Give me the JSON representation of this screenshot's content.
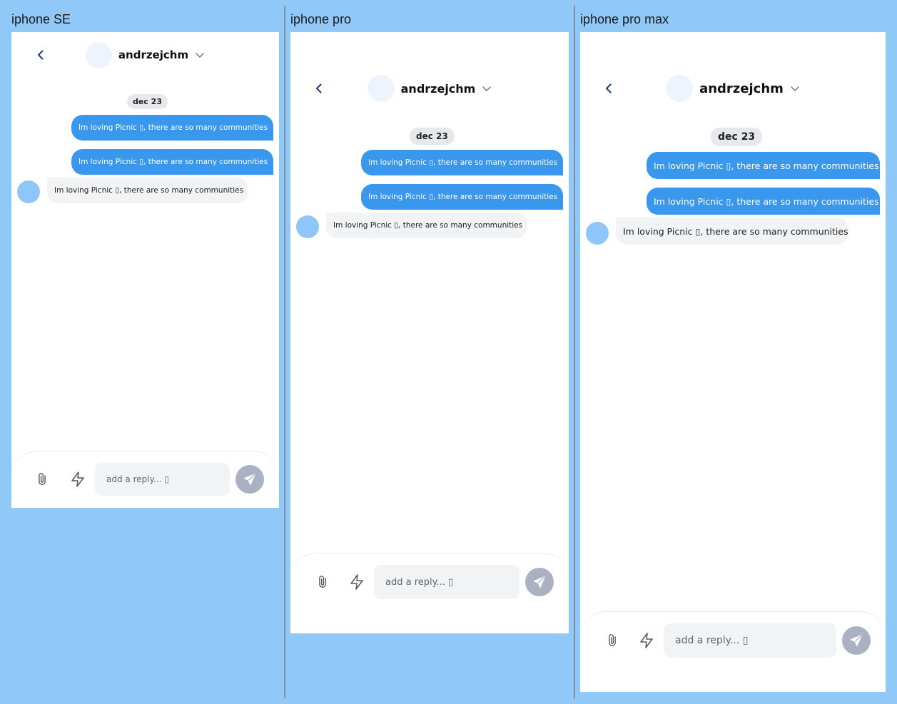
{
  "devices": [
    {
      "label": "iphone SE",
      "header": {
        "username": "andrzejchm"
      },
      "date": "dec 23",
      "messages": [
        {
          "text": "Im loving Picnic ▯, there are so many communities"
        },
        {
          "text": "Im loving Picnic ▯, there are so many communities"
        },
        {
          "text": "Im loving Picnic ▯, there are so many communities"
        }
      ],
      "composer": {
        "placeholder": "add a reply... ▯"
      }
    },
    {
      "label": "iphone pro",
      "header": {
        "username": "andrzejchm"
      },
      "date": "dec 23",
      "messages": [
        {
          "text": "Im loving Picnic ▯, there are so many communities"
        },
        {
          "text": "Im loving Picnic ▯, there are so many communities"
        },
        {
          "text": "Im loving Picnic ▯, there are so many communities"
        }
      ],
      "composer": {
        "placeholder": "add a reply... ▯"
      }
    },
    {
      "label": "iphone pro max",
      "header": {
        "username": "andrzejchm"
      },
      "date": "dec 23",
      "messages": [
        {
          "text": "Im loving Picnic ▯, there are so many communities"
        },
        {
          "text": "Im loving Picnic ▯, there are so many communities"
        },
        {
          "text": "Im loving Picnic ▯, there are so many communities"
        }
      ],
      "composer": {
        "placeholder": "add a reply... ▯"
      }
    }
  ],
  "icons": {
    "back": "chevron-left-icon",
    "dropdown": "chevron-down-icon",
    "attach": "paperclip-icon",
    "quick": "lightning-icon",
    "send": "send-icon"
  },
  "colors": {
    "background": "#90c8f8",
    "outgoing_bubble": "#3a97ee",
    "incoming_bubble": "#f2f3f5",
    "avatar": "#8ec6fa",
    "send_button": "#a9b1c2",
    "back_icon": "#1f3a6b"
  }
}
